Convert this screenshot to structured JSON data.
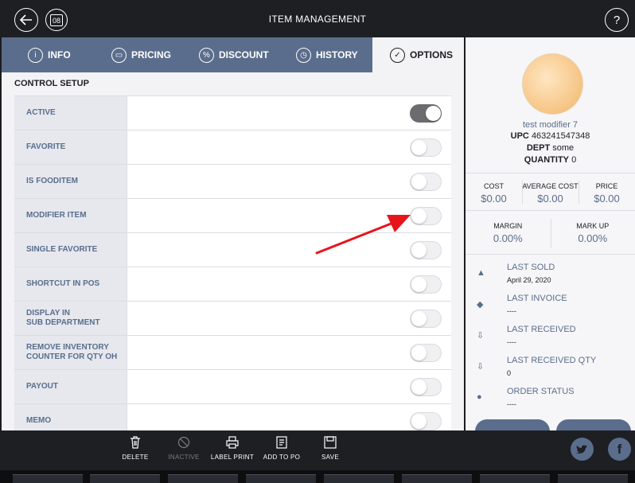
{
  "header": {
    "title": "ITEM MANAGEMENT",
    "back_icon": "back-arrow-icon",
    "calendar_badge": "08",
    "help_label": "?"
  },
  "tabs": [
    {
      "label": "INFO",
      "icon": "info-icon",
      "glyph": "i"
    },
    {
      "label": "PRICING",
      "icon": "card-icon",
      "glyph": "▭"
    },
    {
      "label": "DISCOUNT",
      "icon": "percent-icon",
      "glyph": "%"
    },
    {
      "label": "HISTORY",
      "icon": "clock-icon",
      "glyph": "◷"
    },
    {
      "label": "OPTIONS",
      "icon": "check-circle-icon",
      "glyph": "✓"
    }
  ],
  "active_tab": "OPTIONS",
  "control_setup": {
    "title": "CONTROL SETUP",
    "rows": [
      {
        "label": "ACTIVE",
        "on": true
      },
      {
        "label": "FAVORITE",
        "on": false
      },
      {
        "label": "IS FOODITEM",
        "on": false
      },
      {
        "label": "MODIFIER ITEM",
        "on": false
      },
      {
        "label": "SINGLE FAVORITE",
        "on": false
      },
      {
        "label": "SHORTCUT IN POS",
        "on": false
      },
      {
        "label": "DISPLAY IN\nSUB DEPARTMENT",
        "on": false
      },
      {
        "label": "REMOVE INVENTORY\nCOUNTER FOR QTY OH",
        "on": false
      },
      {
        "label": "PAYOUT",
        "on": false
      },
      {
        "label": "MEMO",
        "on": false
      }
    ]
  },
  "product": {
    "name": "test modifier 7",
    "upc_label": "UPC",
    "upc": "463241547348",
    "dept_label": "DEPT",
    "dept": "some",
    "quantity_label": "QUANTITY",
    "quantity": "0"
  },
  "costs": [
    {
      "label": "COST",
      "value": "$0.00"
    },
    {
      "label": "AVERAGE COST",
      "value": "$0.00"
    },
    {
      "label": "PRICE",
      "value": "$0.00"
    }
  ],
  "margins": [
    {
      "label": "MARGIN",
      "value": "0.00%"
    },
    {
      "label": "MARK UP",
      "value": "0.00%"
    }
  ],
  "stats": [
    {
      "label": "LAST SOLD",
      "value": "April 29, 2020",
      "icon": "bag-icon",
      "glyph": "▲"
    },
    {
      "label": "LAST INVOICE",
      "value": "----",
      "icon": "layers-icon",
      "glyph": "◆"
    },
    {
      "label": "LAST RECEIVED",
      "value": "----",
      "icon": "inbox-down-icon",
      "glyph": "⇩"
    },
    {
      "label": "LAST RECEIVED QTY",
      "value": "0",
      "icon": "inbox-down-icon",
      "glyph": "⇩"
    },
    {
      "label": "ORDER STATUS",
      "value": "----",
      "icon": "timer-icon",
      "glyph": "●"
    }
  ],
  "toolbar": {
    "actions": [
      {
        "label": "DELETE",
        "icon": "trash-icon",
        "glyph": "🗑",
        "enabled": true
      },
      {
        "label": "INACTIVE",
        "icon": "block-icon",
        "glyph": "⊘",
        "enabled": false
      },
      {
        "label": "LABEL PRINT",
        "icon": "printer-icon",
        "glyph": "⎙",
        "enabled": true
      },
      {
        "label": "ADD TO PO",
        "icon": "list-doc-icon",
        "glyph": "☰",
        "enabled": true
      },
      {
        "label": "SAVE",
        "icon": "save-icon",
        "glyph": "▣",
        "enabled": true
      }
    ]
  },
  "social": {
    "twitter_icon": "twitter-icon",
    "facebook_icon": "facebook-icon",
    "facebook_letter": "f"
  },
  "colors": {
    "accent": "#5a6d8c",
    "dark": "#1e1f23",
    "annotation_arrow": "#e8141b"
  }
}
